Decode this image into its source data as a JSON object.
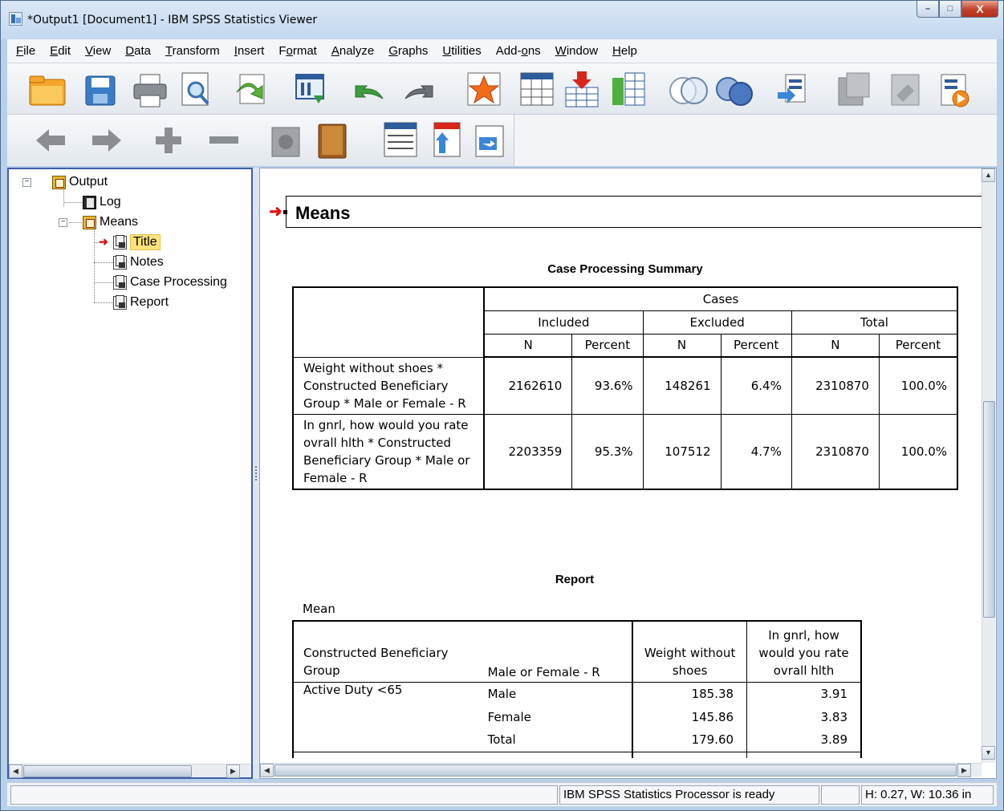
{
  "window": {
    "title": "*Output1 [Document1] - IBM SPSS Statistics Viewer",
    "min_label": "–",
    "max_label": "□",
    "close_label": "X"
  },
  "menu": [
    {
      "label": "File",
      "u": "F",
      "rest": "ile"
    },
    {
      "label": "Edit",
      "u": "E",
      "rest": "dit"
    },
    {
      "label": "View",
      "u": "V",
      "rest": "iew"
    },
    {
      "label": "Data",
      "u": "D",
      "rest": "ata"
    },
    {
      "label": "Transform",
      "u": "T",
      "rest": "ransform"
    },
    {
      "label": "Insert",
      "u": "I",
      "rest": "nsert"
    },
    {
      "label": "Format",
      "u": "o",
      "pre": "F",
      "rest": "rmat"
    },
    {
      "label": "Analyze",
      "u": "A",
      "rest": "nalyze"
    },
    {
      "label": "Graphs",
      "u": "G",
      "rest": "raphs"
    },
    {
      "label": "Utilities",
      "u": "U",
      "rest": "tilities"
    },
    {
      "label": "Add-ons",
      "pre": "Add-",
      "u": "o",
      "rest": "ns"
    },
    {
      "label": "Window",
      "u": "W",
      "rest": "indow"
    },
    {
      "label": "Help",
      "u": "H",
      "rest": "elp"
    }
  ],
  "tree": {
    "output": "Output",
    "log": "Log",
    "means": "Means",
    "title": "Title",
    "notes": "Notes",
    "case_processing": "Case Processing",
    "report": "Report"
  },
  "content": {
    "heading": "Means",
    "cps": {
      "caption": "Case Processing Summary",
      "cases": "Cases",
      "included": "Included",
      "excluded": "Excluded",
      "total": "Total",
      "n": "N",
      "percent": "Percent",
      "rows": [
        {
          "label": "Weight without shoes  * Constructed Beneficiary Group * Male or Female  - R",
          "inc_n": "2162610",
          "inc_pct": "93.6%",
          "exc_n": "148261",
          "exc_pct": "6.4%",
          "tot_n": "2310870",
          "tot_pct": "100.0%"
        },
        {
          "label": "In gnrl, how would you rate ovrall hlth  * Constructed Beneficiary Group * Male or Female  - R",
          "inc_n": "2203359",
          "inc_pct": "95.3%",
          "exc_n": "107512",
          "exc_pct": "4.7%",
          "tot_n": "2310870",
          "tot_pct": "100.0%"
        }
      ]
    },
    "report": {
      "caption": "Report",
      "stat": "Mean",
      "col_group": "Constructed Beneficiary Group",
      "col_sex": "Male or Female  - R",
      "col_weight": "Weight without shoes",
      "col_health": "In gnrl, how would you rate ovrall hlth",
      "group": "Active Duty <65",
      "rows": [
        {
          "sex": "Male",
          "weight": "185.38",
          "health": "3.91"
        },
        {
          "sex": "Female",
          "weight": "145.86",
          "health": "3.83"
        },
        {
          "sex": "Total",
          "weight": "179.60",
          "health": "3.89"
        }
      ]
    }
  },
  "status": {
    "processor": "IBM SPSS Statistics Processor is ready",
    "dimensions": "H: 0.27, W: 10.36 in"
  },
  "colors": {
    "accent_red": "#e01010",
    "selection": "#ffe37a",
    "pane_border": "#3a5fa8"
  }
}
